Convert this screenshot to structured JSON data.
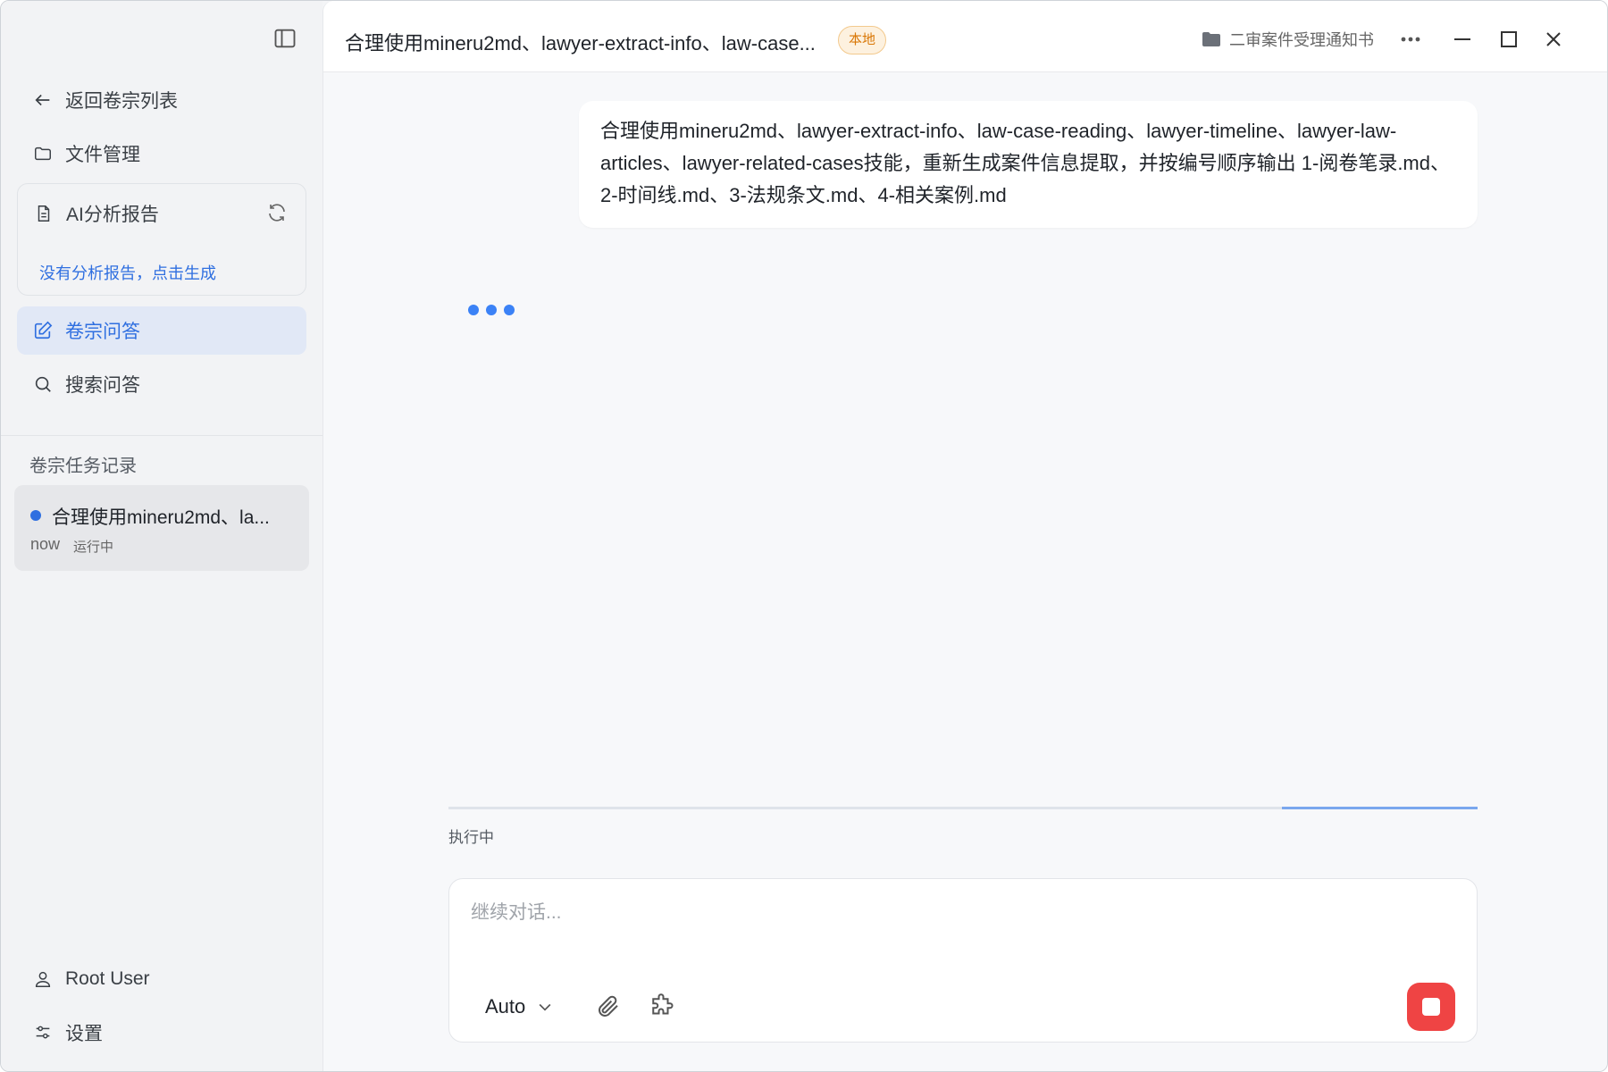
{
  "sidebar": {
    "back_label": "返回卷宗列表",
    "files_label": "文件管理",
    "report": {
      "title": "AI分析报告",
      "empty_link": "没有分析报告，点击生成"
    },
    "qa_label": "卷宗问答",
    "search_label": "搜索问答",
    "tasks_section_title": "卷宗任务记录",
    "tasks": [
      {
        "title": "合理使用mineru2md、la...",
        "time": "now",
        "status": "运行中"
      }
    ],
    "user_name": "Root User",
    "settings_label": "设置"
  },
  "topbar": {
    "title": "合理使用mineru2md、lawyer-extract-info、law-case...",
    "badge": "本地",
    "folder_name": "二审案件受理通知书"
  },
  "chat": {
    "user_message": "合理使用mineru2md、lawyer-extract-info、law-case-reading、lawyer-timeline、lawyer-law-articles、lawyer-related-cases技能，重新生成案件信息提取，并按编号顺序输出 1-阅卷笔录.md、2-时间线.md、3-法规条文.md、4-相关案例.md"
  },
  "status": {
    "label": "执行中",
    "progress_fraction": 0.19
  },
  "composer": {
    "placeholder": "继续对话...",
    "mode": "Auto"
  },
  "colors": {
    "accent": "#2f6fe0",
    "stop": "#ef4444",
    "badge": "#d97706"
  }
}
